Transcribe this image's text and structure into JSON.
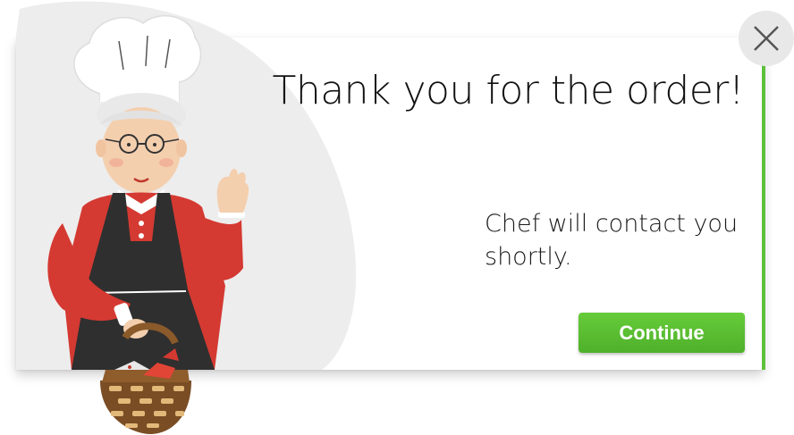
{
  "modal": {
    "title": "Thank you for the order!",
    "message": "Chef will contact you shortly.",
    "continue_label": "Continue"
  },
  "icons": {
    "close": "close-icon",
    "illustration": "chef-grandma-illustration"
  },
  "colors": {
    "accent": "#5ec13b",
    "button": "#5cbf33",
    "close_bg": "#e8e8e8"
  }
}
